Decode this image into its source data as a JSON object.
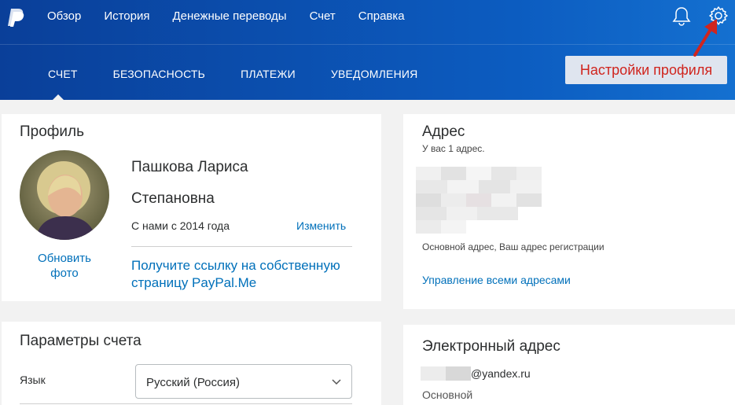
{
  "nav": {
    "items": [
      "Обзор",
      "История",
      "Денежные переводы",
      "Счет",
      "Справка"
    ]
  },
  "subnav": {
    "tabs": [
      "Счет",
      "Безопасность",
      "Платежи",
      "Уведомления"
    ]
  },
  "annotation": {
    "text": "Настройки профиля",
    "color": "#d0251e"
  },
  "profile": {
    "title": "Профиль",
    "name_line1": "Пашкова Лариса",
    "name_line2": "Степановна",
    "since": "С нами с 2014 года",
    "change_link": "Изменить",
    "update_photo": "Обновить фото",
    "paypal_me_link": "Получите ссылку на собственную страницу PayPal.Me"
  },
  "address": {
    "title": "Адрес",
    "count_text": "У вас 1 адрес.",
    "note": "Основной адрес, Ваш адрес регистрации",
    "manage_link": "Управление всеми адресами"
  },
  "params": {
    "title": "Параметры счета",
    "language_label": "Язык",
    "language_value": "Русский (Россия)"
  },
  "email": {
    "title": "Электронный адрес",
    "domain": "@yandex.ru",
    "primary_label": "Основной"
  },
  "icons": [
    "paypal-logo-icon",
    "bell-icon",
    "gear-icon",
    "chevron-down-icon",
    "red-arrow-icon"
  ],
  "colors": {
    "header_start": "#0a3f99",
    "header_end": "#1470d0",
    "link": "#0070ba",
    "accent_red": "#d0251e"
  }
}
